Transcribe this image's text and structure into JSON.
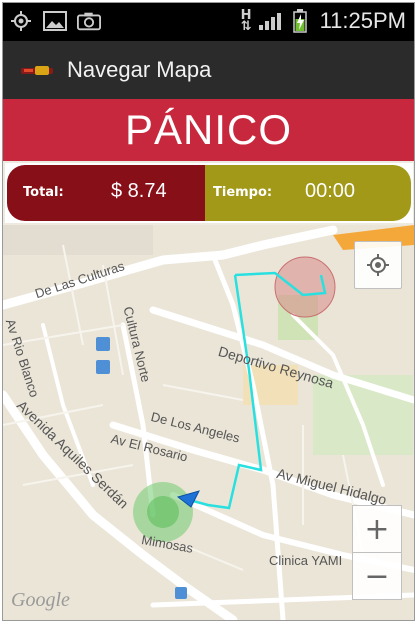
{
  "status_bar": {
    "left_icons": [
      "gps-icon",
      "image-icon",
      "camera-icon"
    ],
    "network_type": "H",
    "time": "11:25PM"
  },
  "action_bar": {
    "title": "Navegar Mapa"
  },
  "panic_button": {
    "label": "PÁNICO",
    "color": "#c8283d"
  },
  "fare": {
    "total_label": "Total:",
    "total_value": "$ 8.74",
    "time_label": "Tiempo:",
    "time_value": "00:00",
    "total_color": "#870f17",
    "time_color": "#a19917"
  },
  "map": {
    "street_labels": [
      "De Las Culturas",
      "Av Rio Blanco",
      "Cultura Norte",
      "Deportivo Reynosa",
      "Avenida Aquiles Serdán",
      "De Los Angeles",
      "Av El Rosario",
      "Av Miguel Hidalgo",
      "Mimosas",
      "Clinica YAMI"
    ],
    "zoom_in": "+",
    "zoom_out": "−",
    "attribution": "Google",
    "route_color": "#29e0e0"
  }
}
